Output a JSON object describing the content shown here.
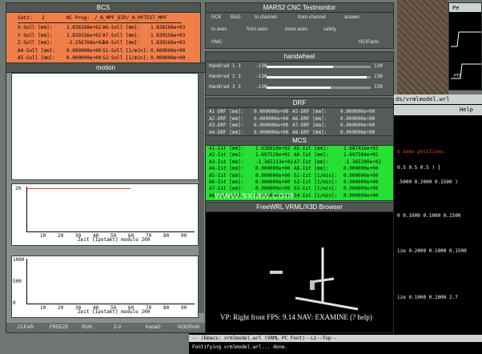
{
  "bcs": {
    "title": "BCS",
    "satz_label": "Satz:",
    "satz_value": "2",
    "nc_prog_label": "NC Prog:",
    "nc_prog_value": "/_N_MPF_DIR/_N_MYTEST_MPF",
    "rows": [
      {
        "l1": "X-Soll [mm]:",
        "v1": "1.838168e+02",
        "l2": "A6-Soll [mm]:",
        "v2": "1.838168e+03"
      },
      {
        "l1": "Y-Soll [mm]:",
        "v1": "1.839156e+02",
        "l2": "A7-Soll [mm]:",
        "v2": "1.839156e+03"
      },
      {
        "l1": "Z-Soll [mm]:",
        "v1": "-2.256768e+02",
        "l2": "A8-Soll [mm]:",
        "v2": "1.839168e+03"
      },
      {
        "l1": "A4-Soll [mm]:",
        "v1": "0.000000e+00",
        "l2": "S1-Soll [1/min]:",
        "v2": "0.000000e+00"
      },
      {
        "l1": "A5-Soll [mm]:",
        "v1": "0.000000e+00",
        "l2": "S2-Soll [1/min]:",
        "v2": "0.000000e+00"
      }
    ]
  },
  "motion": {
    "title": "motion",
    "plot1_xticks": [
      "10",
      "20",
      "30",
      "40",
      "50",
      "60",
      "70",
      "80",
      "90"
    ],
    "plot1_ytick": "20",
    "plot1_xlabel": "Zeit [Ipotakt] modulo 200",
    "plot2_yticks": [
      "1000",
      "500",
      "0"
    ],
    "plot2_xticks": [
      "10",
      "20",
      "30",
      "40",
      "50",
      "60",
      "70",
      "80",
      "90"
    ],
    "plot2_xlabel": "Zeit [Ipotakt] modulo 200",
    "buttons": [
      "CLEAR",
      "FREEZE",
      "RUN",
      "Z-V",
      "Kanal2",
      "NODRAW"
    ]
  },
  "testmonitor": {
    "title": "MARS2 CNC Testmonitor",
    "row1": [
      "NCK",
      "BAG",
      "to channel",
      "from channel",
      "answer"
    ],
    "row2": [
      "to axes",
      "from axes",
      "more axes",
      "safety"
    ],
    "row3_left": "HMC",
    "row3_right": "NCIFacts"
  },
  "handwheel": {
    "title": "handwheel",
    "rows": [
      {
        "label": "Handrad 1 3",
        "min": "-130",
        "max": "130",
        "value": 35
      },
      {
        "label": "Handrad 2 3",
        "min": "-130",
        "max": "130",
        "value": 120
      },
      {
        "label": "Handrad 3 3",
        "min": "-130",
        "max": "130",
        "value": 30
      }
    ]
  },
  "drf": {
    "title": "DRF",
    "rows": [
      {
        "l1": "A1-DRF [mm]:",
        "v1": "0.000000e+00",
        "l2": "A5-DRF [mm]:",
        "v2": "0.000000e+00"
      },
      {
        "l1": "A2-DRF [mm]:",
        "v1": "0.000000e+00",
        "l2": "A6-DRF [mm]:",
        "v2": "0.000000e+00"
      },
      {
        "l1": "A3-DRF [mm]:",
        "v1": "0.000000e+00",
        "l2": "A7-DRF [mm]:",
        "v2": "0.000000e+00"
      },
      {
        "l1": "A4-DRF [mm]:",
        "v1": "0.000000e+00",
        "l2": "A8-DRF [mm]:",
        "v2": "0.000000e+00"
      }
    ]
  },
  "mcs": {
    "title": "MCS",
    "rows": [
      {
        "l1": "A1-Ist [mm]:",
        "v1": "1.636610e+02",
        "l2": "A5-Ist [mm]:",
        "v2": "1.687416e+02"
      },
      {
        "l1": "A2-Ist [mm]:",
        "v1": "1.697520e+02",
        "l2": "A6-Ist [mm]:",
        "v2": "1.697504e+02"
      },
      {
        "l1": "A3-Ist [mm]:",
        "v1": "-1.365213e+02",
        "l2": "A7-Ist [mm]:",
        "v2": "-1.365200e+02"
      },
      {
        "l1": "A4-Ist [mm]:",
        "v1": "0.000000e+00",
        "l2": "A8-Ist [mm]:",
        "v2": "0.000000e+00"
      },
      {
        "l1": "A5-Ist [mm]:",
        "v1": "0.000000e+00",
        "l2": "S1-Ist [1/min]:",
        "v2": "0.000000e+00"
      },
      {
        "l1": "A6-Ist [mm]:",
        "v1": "0.000000e+00",
        "l2": "S2-Ist [1/min]:",
        "v2": "0.000000e+00"
      },
      {
        "l1": "A7-Ist [mm]:",
        "v1": "0.000000e+00",
        "l2": "S3-Ist [1/min]:",
        "v2": "0.000000e+00"
      },
      {
        "l1": "A8-Ist [mm]:",
        "v1": "0.000000e+00",
        "l2": "S4-Ist [1/min]:",
        "v2": "0.000000e+00"
      }
    ]
  },
  "vrml": {
    "title": "FreeWRL VRML/X3D Browser",
    "status": "VP: Right front   FPS: 9.14  NAV: EXAMINE  (? help)"
  },
  "editor": {
    "title": "ds/vrmlmodel.wrl",
    "help": "Help",
    "lines": [
      {
        "text": "e axes positions.",
        "color": "#e8412d"
      },
      {
        "text": "0.5 0.5 0.5 ) }",
        "color": "#ffffff"
      },
      {
        "text": ".5000 0.2000 0.1500 )",
        "color": "#ffffff"
      },
      {
        "text": "0 0.1000 0.1000 0.1500",
        "color": "#ffffff"
      },
      {
        "text": "ize 0.2000 0.1000 0.1500",
        "color": "#ffffff"
      },
      {
        "text": "ize 0.1000 0.1000 2.7",
        "color": "#ffffff"
      }
    ]
  },
  "perf": {
    "title": "Pe",
    "label": "PTS"
  },
  "bottom": {
    "modeline": "-- (Emacs: vrmlmodel.wrl   (VRML PC Font)--L1--Top--",
    "minibuffer": "Fontifying vrmlmodel.wrl... done."
  },
  "watermark": "www.sxiaw.com",
  "colors": {
    "bcs_bg": "#f07f4a",
    "mcs_bg": "#26e034",
    "panel_bg": "#555c58",
    "editor_bg": "#000000"
  }
}
